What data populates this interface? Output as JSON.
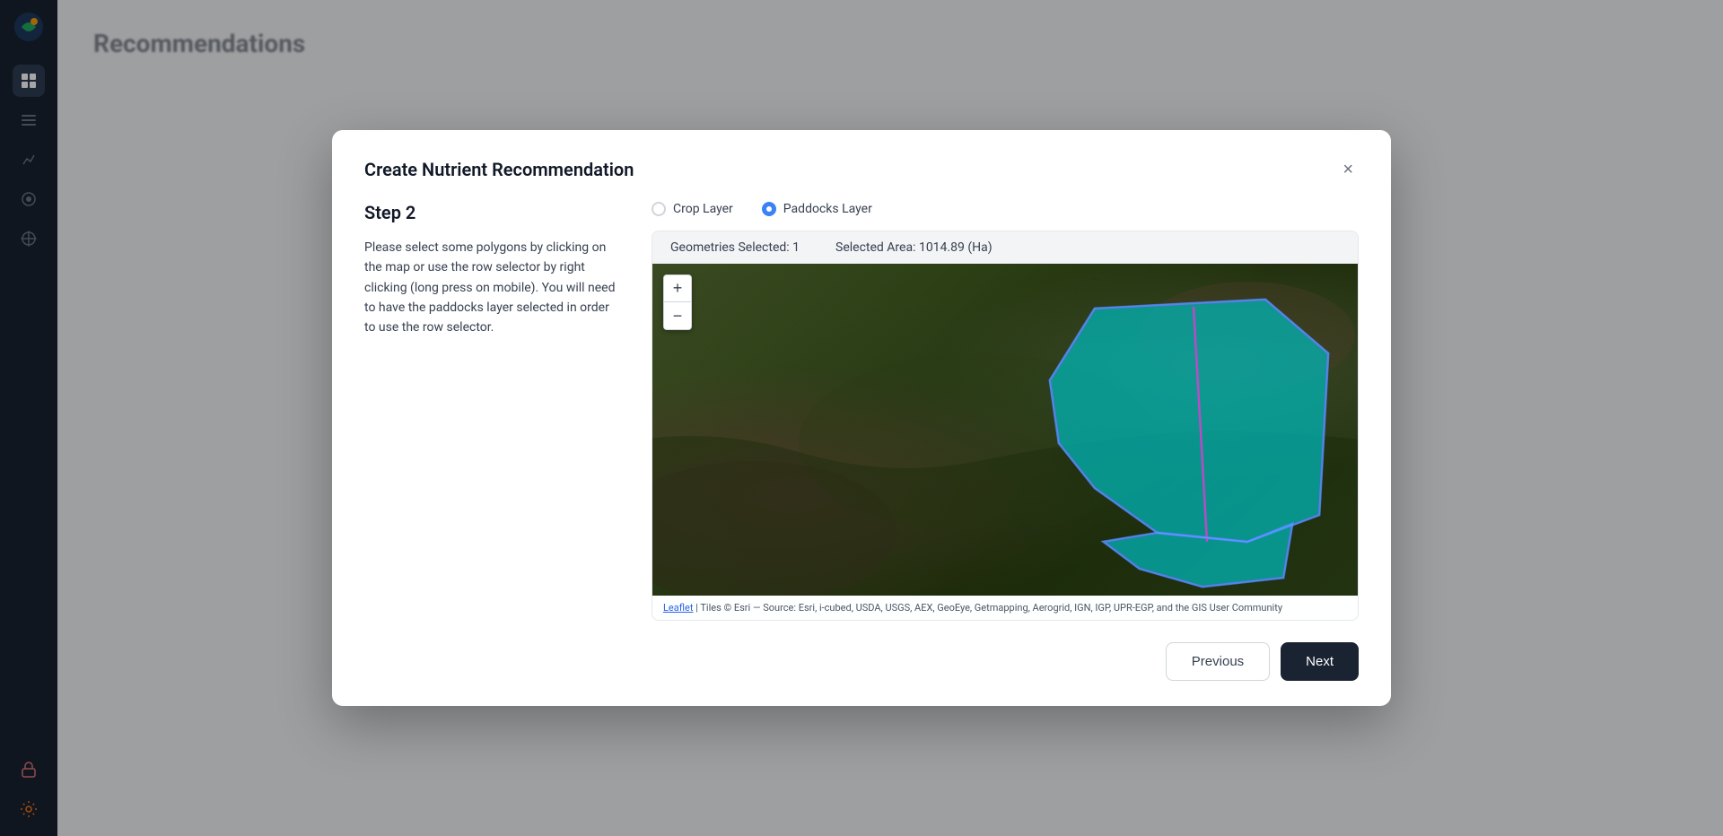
{
  "app": {
    "title": "Recommendations"
  },
  "modal": {
    "title": "Create Nutrient Recommendation",
    "close_label": "×",
    "step_label": "Step 2",
    "step_description": "Please select some polygons by clicking on the map or use the row selector by right clicking (long press on mobile). You will need to have the paddocks layer selected in order to use the row selector.",
    "layers": {
      "crop_label": "Crop Layer",
      "paddocks_label": "Paddocks Layer"
    },
    "map_stats": {
      "geometries_label": "Geometries Selected: 1",
      "area_label": "Selected Area: 1014.89 (Ha)"
    },
    "map_attribution": "| Tiles © Esri — Source: Esri, i-cubed, USDA, USGS, AEX, GeoEye, Getmapping, Aerogrid, IGN, IGP, UPR-EGP, and the GIS User Community",
    "leaflet_text": "Leaflet",
    "zoom_in": "+",
    "zoom_out": "−",
    "buttons": {
      "previous": "Previous",
      "next": "Next"
    }
  },
  "sidebar": {
    "icons": [
      "🌐",
      "⊞",
      "🗂",
      "📊",
      "◎",
      "☁"
    ],
    "bottom_icons": [
      "🔑",
      "❋"
    ]
  }
}
